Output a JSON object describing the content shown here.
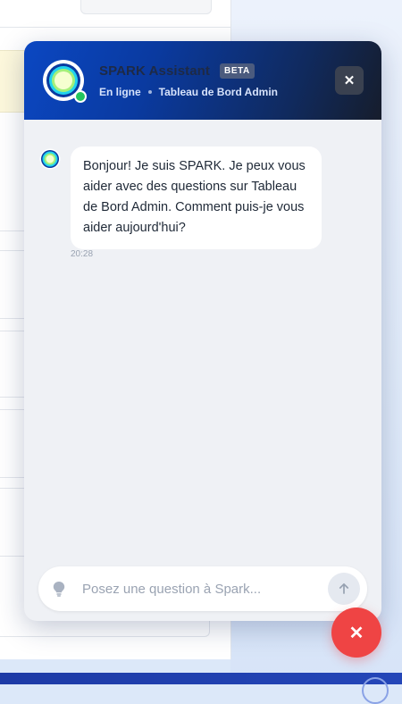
{
  "chat": {
    "title": "SPARK Assistant",
    "badge": "BETA",
    "status": "En ligne",
    "context": "Tableau de Bord Admin",
    "close_icon": "close-icon",
    "messages": [
      {
        "sender": "assistant",
        "text": "Bonjour! Je suis SPARK. Je peux vous aider avec des questions sur Tableau de Bord Admin. Comment puis-je vous aider aujourd'hui?",
        "time": "20:28"
      }
    ],
    "input": {
      "placeholder": "Posez une question à Spark...",
      "value": ""
    },
    "colors": {
      "accent": "#0b47c2",
      "online": "#22c55e",
      "fab": "#ef4444"
    }
  },
  "fab": {
    "icon": "close-icon"
  }
}
